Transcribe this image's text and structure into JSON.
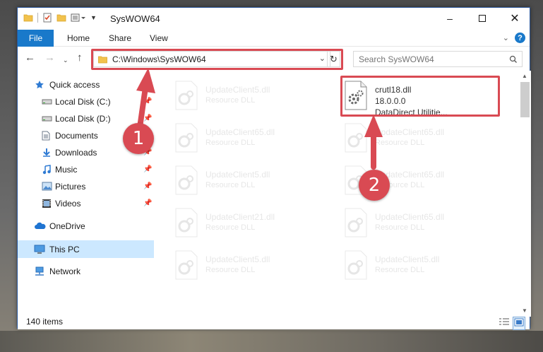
{
  "window": {
    "title": "SysWOW64"
  },
  "ribbon": {
    "tabs": [
      "File",
      "Home",
      "Share",
      "View"
    ]
  },
  "navbar": {
    "address": "C:\\Windows\\SysWOW64",
    "search_placeholder": "Search SysWOW64"
  },
  "sidebar": {
    "items": [
      {
        "label": "Quick access",
        "icon": "star-icon",
        "pinned": false
      },
      {
        "label": "Local Disk (C:)",
        "icon": "drive-icon",
        "pinned": true
      },
      {
        "label": "Local Disk (D:)",
        "icon": "drive-icon",
        "pinned": true
      },
      {
        "label": "Documents",
        "icon": "documents-icon",
        "pinned": true
      },
      {
        "label": "Downloads",
        "icon": "downloads-icon",
        "pinned": true
      },
      {
        "label": "Music",
        "icon": "music-icon",
        "pinned": true
      },
      {
        "label": "Pictures",
        "icon": "pictures-icon",
        "pinned": true
      },
      {
        "label": "Videos",
        "icon": "videos-icon",
        "pinned": true
      },
      {
        "label": "OneDrive",
        "icon": "cloud-icon",
        "pinned": false
      },
      {
        "label": "This PC",
        "icon": "computer-icon",
        "pinned": false,
        "selected": true
      },
      {
        "label": "Network",
        "icon": "network-icon",
        "pinned": false
      }
    ]
  },
  "files": [
    {
      "name": "UpdateClient5.dll",
      "desc": "Resource DLL"
    },
    {
      "name": "crutl18.dll",
      "version": "18.0.0.0",
      "desc": "DataDirect Utilitie...",
      "highlighted": true
    },
    {
      "name": "UpdateClient65.dll",
      "desc": "Resource DLL"
    },
    {
      "name": "UpdateClient65.dll",
      "desc": "Resource DLL"
    },
    {
      "name": "UpdateClient5.dll",
      "desc": "Resource DLL"
    },
    {
      "name": "UpdateClient65.dll",
      "desc": "Resource DLL"
    },
    {
      "name": "UpdateClient21.dll",
      "desc": "Resource DLL"
    },
    {
      "name": "UpdateClient65.dll",
      "desc": "Resource DLL"
    },
    {
      "name": "UpdateClient5.dll",
      "desc": "Resource DLL"
    },
    {
      "name": "UpdateClient5.dll",
      "desc": "Resource DLL"
    }
  ],
  "status": {
    "item_count": "140 items"
  },
  "annotations": {
    "step1": "1",
    "step2": "2"
  },
  "colors": {
    "accent": "#1979ca",
    "annotation": "#d94a53",
    "selected_bg": "#cce8ff"
  }
}
